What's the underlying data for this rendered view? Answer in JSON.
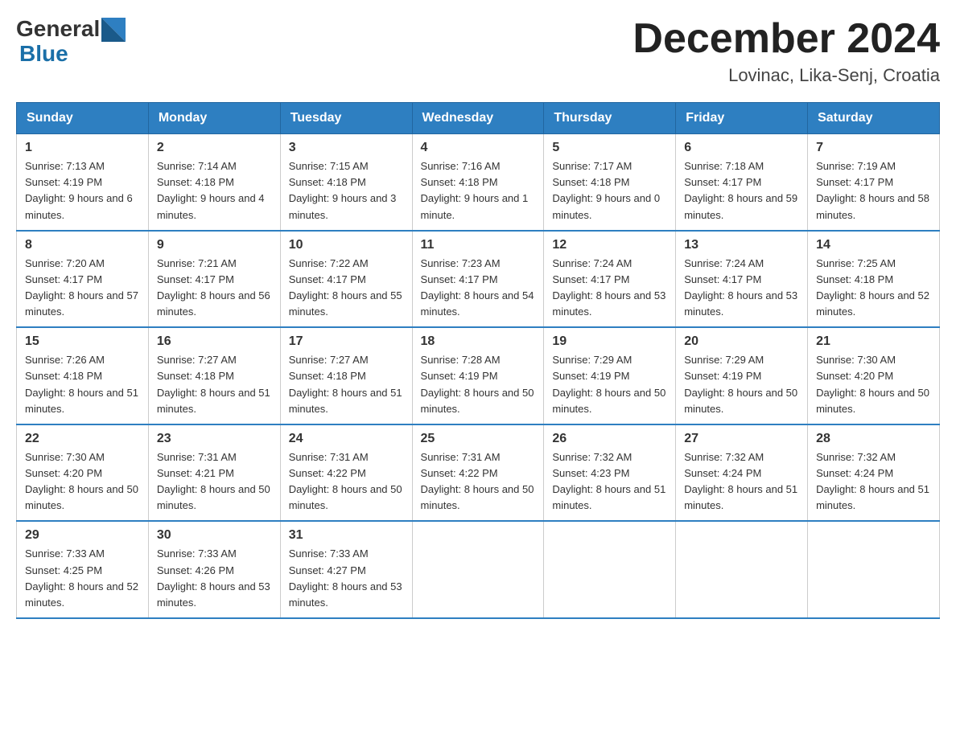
{
  "header": {
    "logo_general": "General",
    "logo_blue": "Blue",
    "month_title": "December 2024",
    "location": "Lovinac, Lika-Senj, Croatia"
  },
  "weekdays": [
    "Sunday",
    "Monday",
    "Tuesday",
    "Wednesday",
    "Thursday",
    "Friday",
    "Saturday"
  ],
  "weeks": [
    [
      {
        "day": "1",
        "sunrise": "7:13 AM",
        "sunset": "4:19 PM",
        "daylight": "9 hours and 6 minutes."
      },
      {
        "day": "2",
        "sunrise": "7:14 AM",
        "sunset": "4:18 PM",
        "daylight": "9 hours and 4 minutes."
      },
      {
        "day": "3",
        "sunrise": "7:15 AM",
        "sunset": "4:18 PM",
        "daylight": "9 hours and 3 minutes."
      },
      {
        "day": "4",
        "sunrise": "7:16 AM",
        "sunset": "4:18 PM",
        "daylight": "9 hours and 1 minute."
      },
      {
        "day": "5",
        "sunrise": "7:17 AM",
        "sunset": "4:18 PM",
        "daylight": "9 hours and 0 minutes."
      },
      {
        "day": "6",
        "sunrise": "7:18 AM",
        "sunset": "4:17 PM",
        "daylight": "8 hours and 59 minutes."
      },
      {
        "day": "7",
        "sunrise": "7:19 AM",
        "sunset": "4:17 PM",
        "daylight": "8 hours and 58 minutes."
      }
    ],
    [
      {
        "day": "8",
        "sunrise": "7:20 AM",
        "sunset": "4:17 PM",
        "daylight": "8 hours and 57 minutes."
      },
      {
        "day": "9",
        "sunrise": "7:21 AM",
        "sunset": "4:17 PM",
        "daylight": "8 hours and 56 minutes."
      },
      {
        "day": "10",
        "sunrise": "7:22 AM",
        "sunset": "4:17 PM",
        "daylight": "8 hours and 55 minutes."
      },
      {
        "day": "11",
        "sunrise": "7:23 AM",
        "sunset": "4:17 PM",
        "daylight": "8 hours and 54 minutes."
      },
      {
        "day": "12",
        "sunrise": "7:24 AM",
        "sunset": "4:17 PM",
        "daylight": "8 hours and 53 minutes."
      },
      {
        "day": "13",
        "sunrise": "7:24 AM",
        "sunset": "4:17 PM",
        "daylight": "8 hours and 53 minutes."
      },
      {
        "day": "14",
        "sunrise": "7:25 AM",
        "sunset": "4:18 PM",
        "daylight": "8 hours and 52 minutes."
      }
    ],
    [
      {
        "day": "15",
        "sunrise": "7:26 AM",
        "sunset": "4:18 PM",
        "daylight": "8 hours and 51 minutes."
      },
      {
        "day": "16",
        "sunrise": "7:27 AM",
        "sunset": "4:18 PM",
        "daylight": "8 hours and 51 minutes."
      },
      {
        "day": "17",
        "sunrise": "7:27 AM",
        "sunset": "4:18 PM",
        "daylight": "8 hours and 51 minutes."
      },
      {
        "day": "18",
        "sunrise": "7:28 AM",
        "sunset": "4:19 PM",
        "daylight": "8 hours and 50 minutes."
      },
      {
        "day": "19",
        "sunrise": "7:29 AM",
        "sunset": "4:19 PM",
        "daylight": "8 hours and 50 minutes."
      },
      {
        "day": "20",
        "sunrise": "7:29 AM",
        "sunset": "4:19 PM",
        "daylight": "8 hours and 50 minutes."
      },
      {
        "day": "21",
        "sunrise": "7:30 AM",
        "sunset": "4:20 PM",
        "daylight": "8 hours and 50 minutes."
      }
    ],
    [
      {
        "day": "22",
        "sunrise": "7:30 AM",
        "sunset": "4:20 PM",
        "daylight": "8 hours and 50 minutes."
      },
      {
        "day": "23",
        "sunrise": "7:31 AM",
        "sunset": "4:21 PM",
        "daylight": "8 hours and 50 minutes."
      },
      {
        "day": "24",
        "sunrise": "7:31 AM",
        "sunset": "4:22 PM",
        "daylight": "8 hours and 50 minutes."
      },
      {
        "day": "25",
        "sunrise": "7:31 AM",
        "sunset": "4:22 PM",
        "daylight": "8 hours and 50 minutes."
      },
      {
        "day": "26",
        "sunrise": "7:32 AM",
        "sunset": "4:23 PM",
        "daylight": "8 hours and 51 minutes."
      },
      {
        "day": "27",
        "sunrise": "7:32 AM",
        "sunset": "4:24 PM",
        "daylight": "8 hours and 51 minutes."
      },
      {
        "day": "28",
        "sunrise": "7:32 AM",
        "sunset": "4:24 PM",
        "daylight": "8 hours and 51 minutes."
      }
    ],
    [
      {
        "day": "29",
        "sunrise": "7:33 AM",
        "sunset": "4:25 PM",
        "daylight": "8 hours and 52 minutes."
      },
      {
        "day": "30",
        "sunrise": "7:33 AM",
        "sunset": "4:26 PM",
        "daylight": "8 hours and 53 minutes."
      },
      {
        "day": "31",
        "sunrise": "7:33 AM",
        "sunset": "4:27 PM",
        "daylight": "8 hours and 53 minutes."
      },
      null,
      null,
      null,
      null
    ]
  ]
}
